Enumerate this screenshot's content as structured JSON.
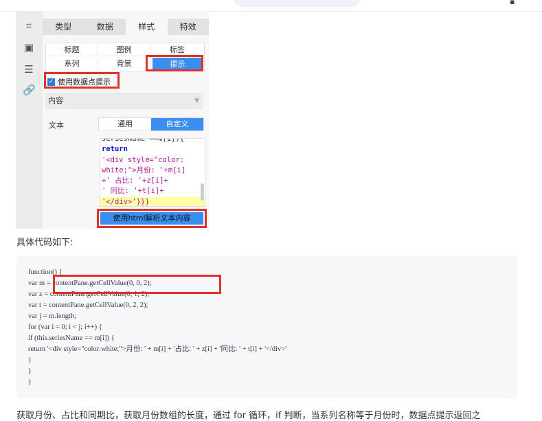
{
  "panel": {
    "tabs": [
      "类型",
      "数据",
      "样式",
      "特效"
    ],
    "active_tab": 2,
    "sub_tabs": [
      "标题",
      "图例",
      "标签",
      "系列",
      "背景",
      "提示"
    ],
    "active_sub_tab": 5,
    "checkbox_label": "使用数据点提示",
    "checkbox_checked": true,
    "section_label": "内容",
    "text_label": "文本",
    "text_modes": [
      "通用",
      "自定义"
    ],
    "active_text_mode": 1,
    "editor_lines": [
      "seriesName ==m[i]){",
      "return",
      "'<div style=\"color:",
      "white;\">月份: '+m[i]",
      "+' 占比: '+z[i]+",
      "' 同比: '+t[i]+",
      "'</div>'}}}"
    ],
    "html_button_label": "使用html解析文本内容"
  },
  "article": {
    "intro": "具体代码如下:",
    "code_lines": [
      "function() {",
      "var m = contentPane.getCellValue(0, 0, 2);",
      "var z = contentPane.getCellValue(0, 1, 2);",
      "var t = contentPane.getCellValue(0, 2, 2);",
      "var j = m.length;",
      "for (var i = 0; i < j; i++) {",
      "if (this.seriesName == m[i]) {",
      "return '<div style=\"color:white;\">月份: ' + m[i] + '占比: ' + z[i] + '同比: ' + t[i] + '</div>'",
      "}",
      "}",
      "}"
    ],
    "outro": "获取月份、占比和同期比，获取月份数组的长度，通过 for 循环，if 判断，当系列名称等于月份时，数据点提示返回之"
  },
  "colors": {
    "accent": "#3a8ef0",
    "highlight_box": "#e0312b"
  }
}
